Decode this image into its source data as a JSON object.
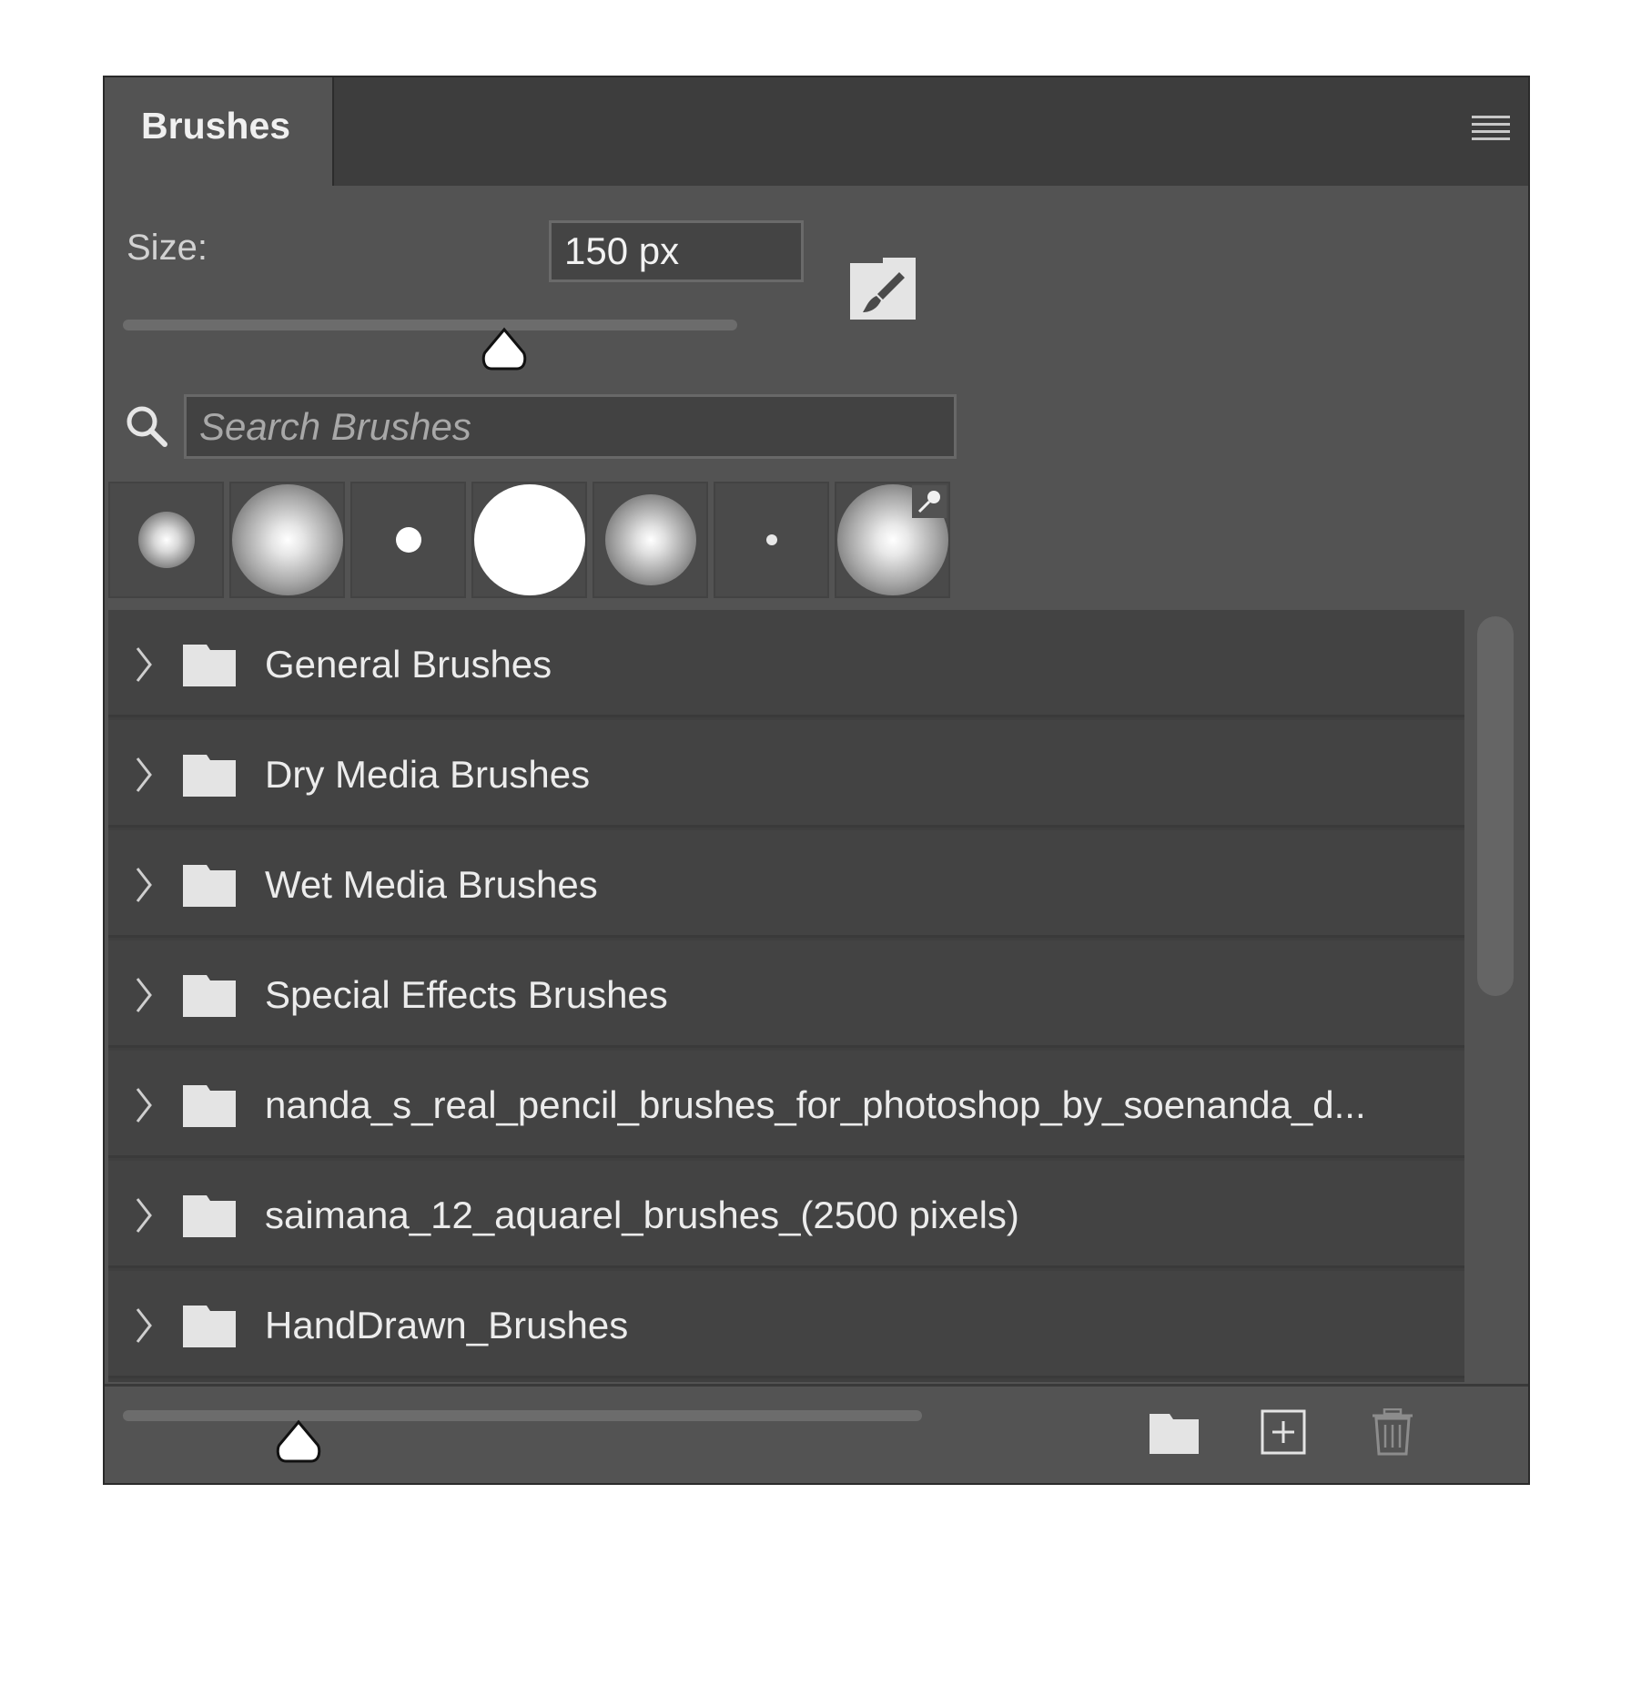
{
  "panel": {
    "tab_label": "Brushes",
    "menu_icon": "hamburger-menu-icon"
  },
  "size": {
    "label": "Size:",
    "value": "150 px",
    "slider_fraction": 0.62,
    "toggle_icon": "brush-icon"
  },
  "search": {
    "icon": "search-icon",
    "placeholder": "Search Brushes"
  },
  "presets": [
    {
      "name": "soft-round-small",
      "soft": true
    },
    {
      "name": "soft-round-large",
      "soft": true
    },
    {
      "name": "hard-round-small",
      "soft": false
    },
    {
      "name": "hard-round-large",
      "soft": false
    },
    {
      "name": "soft-round-medium",
      "soft": true
    },
    {
      "name": "hard-round-tiny",
      "soft": false
    },
    {
      "name": "soft-round-pinned",
      "soft": true,
      "pinned": true
    }
  ],
  "groups": [
    {
      "label": "General Brushes"
    },
    {
      "label": "Dry Media Brushes"
    },
    {
      "label": "Wet Media Brushes"
    },
    {
      "label": "Special Effects Brushes"
    },
    {
      "label": "nanda_s_real_pencil_brushes_for_photoshop_by_soenanda_d..."
    },
    {
      "label": "saimana_12_aquarel_brushes_(2500 pixels)"
    },
    {
      "label": "HandDrawn_Brushes"
    }
  ],
  "footer": {
    "preview_slider_fraction": 0.22,
    "icons": [
      "new-group-folder-icon",
      "new-brush-icon",
      "delete-trash-icon"
    ]
  }
}
